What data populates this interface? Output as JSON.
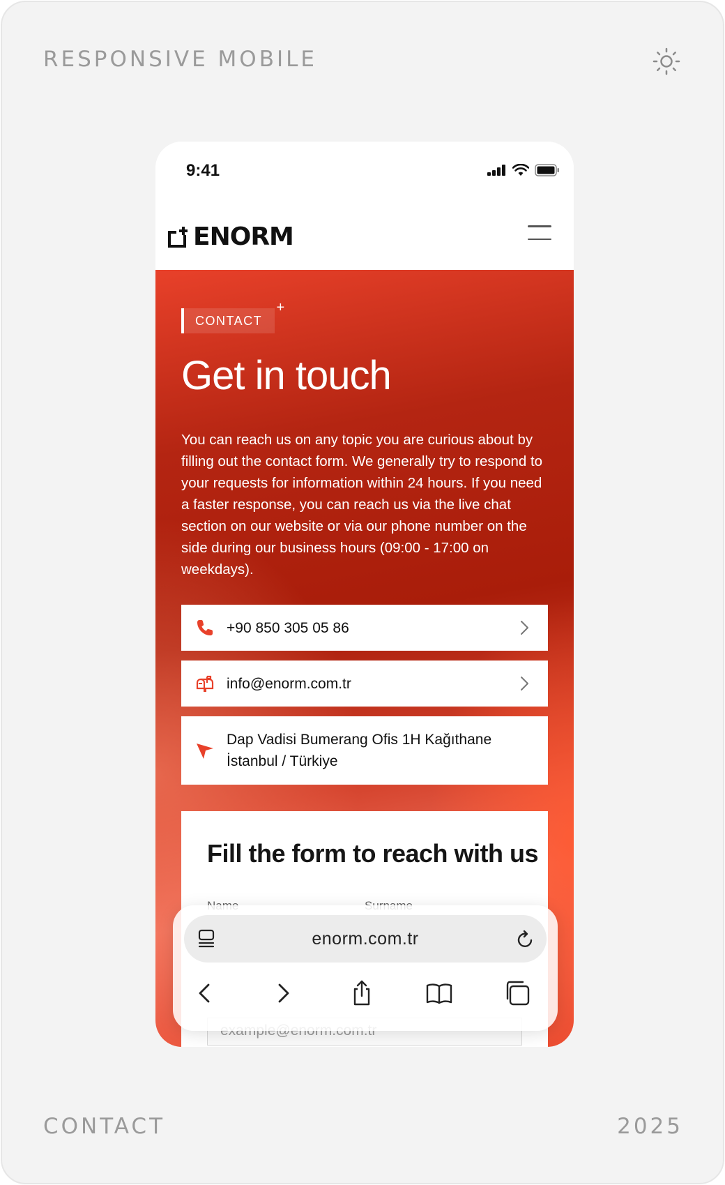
{
  "frame": {
    "top_left_label": "RESPONSIVE MOBILE",
    "bottom_left_label": "CONTACT",
    "bottom_right_label": "2025",
    "theme_icon": "sun-icon"
  },
  "status_bar": {
    "time": "9:41",
    "icons": [
      "cellular-signal-icon",
      "wifi-icon",
      "battery-icon"
    ]
  },
  "navbar": {
    "logo_text": "ENORM",
    "menu_icon": "hamburger-menu-icon"
  },
  "hero": {
    "tag": "CONTACT",
    "headline": "Get in touch",
    "intro": "You can reach us on any topic you are curious about by filling out the contact form. We generally try to respond to your requests for information within 24 hours. If you need a faster response, you can reach us via the live chat section on our website or via our phone number on the side during our business hours (09:00 - 17:00 on weekdays)."
  },
  "contacts": {
    "phone": "+90 850 305 05 86",
    "email": "info@enorm.com.tr",
    "address_line1": "Dap Vadisi Bumerang Ofis 1H Kağıthane",
    "address_line2": "İstanbul / Türkiye"
  },
  "form": {
    "title": "Fill the form to reach with us",
    "name_label": "Name",
    "surname_label": "Surname",
    "email_placeholder": "example@enorm.com.tr"
  },
  "browser": {
    "url": "enorm.com.tr",
    "toolbar": [
      "back-icon",
      "forward-icon",
      "share-icon",
      "bookmarks-icon",
      "tabs-icon"
    ]
  },
  "colors": {
    "accent": "#e8412a",
    "accent_dark": "#a91d0a",
    "frame_bg": "#f3f3f3",
    "label_gray": "#9a9a9a"
  }
}
